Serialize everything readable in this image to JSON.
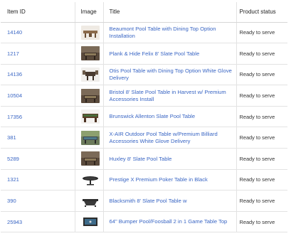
{
  "columns": {
    "item_id": "Item ID",
    "image": "Image",
    "title": "Title",
    "status": "Product status"
  },
  "rows": [
    {
      "id": "14140",
      "title": "Beaumont Pool Table with Dining Top Option Installation",
      "status": "Ready to serve",
      "image_icon": "pool-table-dining-top-thumbnail"
    },
    {
      "id": "1217",
      "title": "Plank & Hide Felix 8' Slate Pool Table",
      "status": "Ready to serve",
      "image_icon": "pool-table-room-thumbnail"
    },
    {
      "id": "14136",
      "title": "Otis Pool Table with Dining Top Option White Glove Delivery",
      "status": "Ready to serve",
      "image_icon": "pool-table-chairs-thumbnail"
    },
    {
      "id": "10504",
      "title": "Bristol 8' Slate Pool Table in Harvest w/ Premium Accessories Install",
      "status": "Ready to serve",
      "image_icon": "pool-table-room-thumbnail"
    },
    {
      "id": "17356",
      "title": "Brunswick Allenton Slate Pool Table",
      "status": "Ready to serve",
      "image_icon": "pool-table-thumbnail"
    },
    {
      "id": "381",
      "title": "X-AIR Outdoor Pool Table w/Premium Billiard Accessories White Glove Delivery",
      "status": "Ready to serve",
      "image_icon": "outdoor-pool-table-thumbnail"
    },
    {
      "id": "5289",
      "title": "Huxley 8' Slate Pool Table",
      "status": "Ready to serve",
      "image_icon": "pool-table-room-thumbnail"
    },
    {
      "id": "1321",
      "title": "Prestige X Premium Poker Table in Black",
      "status": "Ready to serve",
      "image_icon": "poker-table-thumbnail"
    },
    {
      "id": "390",
      "title": "Blacksmith 8' Slate Pool Table w",
      "status": "Ready to serve",
      "image_icon": "black-pool-table-thumbnail"
    },
    {
      "id": "25943",
      "title": "64\" Bumper Pool/Foosball 2 in 1 Game Table Top",
      "status": "Ready to serve",
      "image_icon": "bumper-pool-table-thumbnail"
    }
  ],
  "colors": {
    "link": "#3a66c4",
    "text": "#333333",
    "border": "#e3e3e3"
  }
}
